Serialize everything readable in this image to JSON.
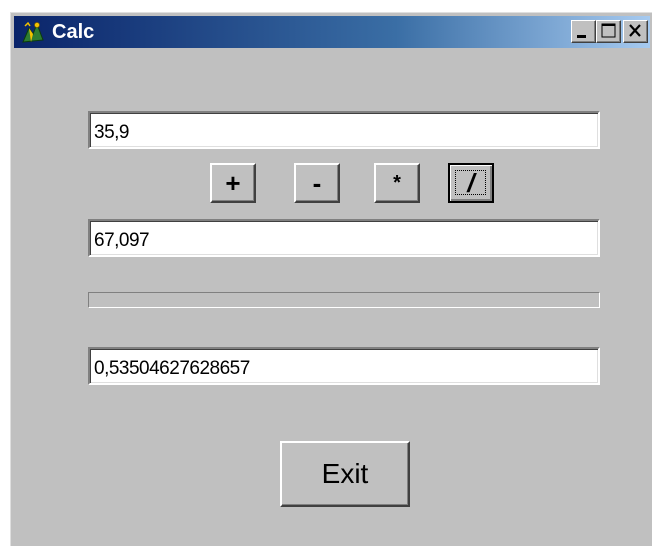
{
  "window": {
    "title": "Calc",
    "icon": "calculator-app-icon",
    "controls": {
      "minimize": "minimize-icon",
      "maximize": "maximize-icon",
      "close": "close-icon"
    }
  },
  "operand_1": {
    "value": "35,9"
  },
  "operators": {
    "add_label": "+",
    "subtract_label": "-",
    "multiply_label": "*",
    "divide_label": "/"
  },
  "operand_2": {
    "value": "67,097"
  },
  "progress": {
    "fraction": 0
  },
  "result": {
    "value": "0,53504627628657"
  },
  "exit_button": {
    "label": "Exit"
  },
  "colors": {
    "window_bg": "#c0c0c0",
    "titlebar_start": "#0a246a",
    "titlebar_end": "#a6caf0",
    "title_text": "#ffffff",
    "field_bg": "#ffffff"
  }
}
